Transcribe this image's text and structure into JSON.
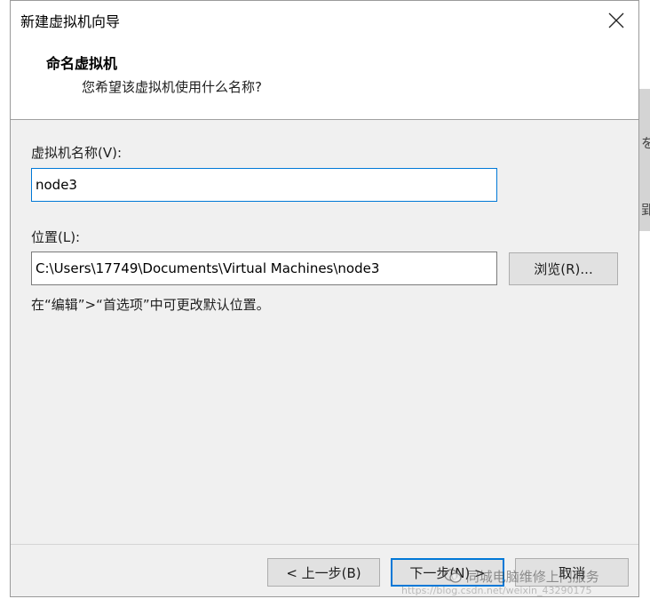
{
  "window": {
    "title": "新建虚拟机向导"
  },
  "header": {
    "title": "命名虚拟机",
    "subtitle": "您希望该虚拟机使用什么名称?"
  },
  "form": {
    "name_label": "虚拟机名称(V):",
    "name_value": "node3",
    "location_label": "位置(L):",
    "location_value": "C:\\Users\\17749\\Documents\\Virtual Machines\\node3",
    "browse_label": "浏览(R)...",
    "hint": "在“编辑”>“首选项”中可更改默认位置。"
  },
  "footer": {
    "back_label": "< 上一步(B)",
    "next_label": "下一步(N) >",
    "cancel_label": "取消"
  },
  "background": {
    "char_top": "を",
    "char_bottom": "郢"
  },
  "watermark": {
    "text": "同城电脑维修上门服务",
    "url": "https://blog.csdn.net/weixin_43290175"
  },
  "colors": {
    "accent": "#0078d7",
    "dialog_bg": "#f0f0f0",
    "button_bg": "#e1e1e1"
  }
}
